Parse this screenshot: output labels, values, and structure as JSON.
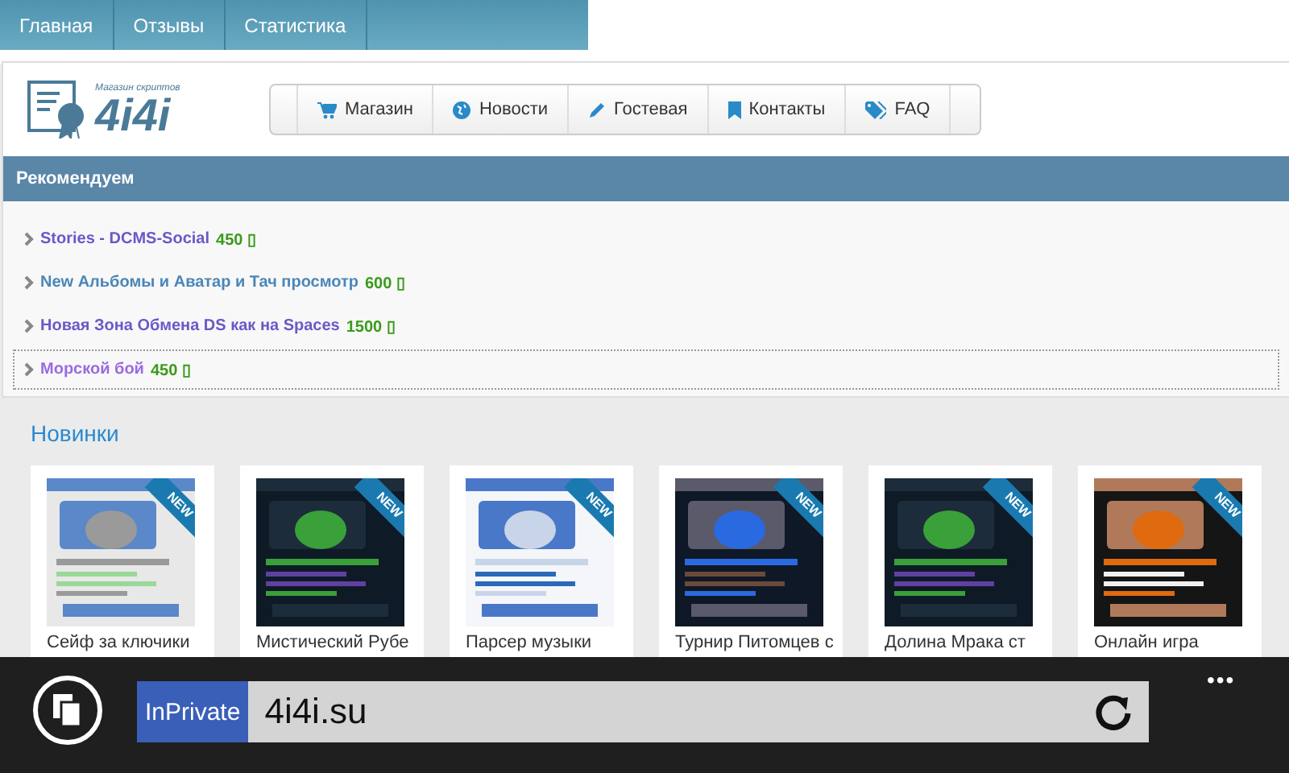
{
  "top_nav": [
    {
      "label": "Главная"
    },
    {
      "label": "Отзывы"
    },
    {
      "label": "Статистика"
    }
  ],
  "logo": {
    "tagline": "Магазин скриптов",
    "text": "4i4i"
  },
  "menu": [
    {
      "label": "Магазин"
    },
    {
      "label": "Новости"
    },
    {
      "label": "Гостевая"
    },
    {
      "label": "Контакты"
    },
    {
      "label": "FAQ"
    }
  ],
  "recommended": {
    "title": "Рекомендуем",
    "items": [
      {
        "name": "Stories - DCMS-Social",
        "price": "450 ▯",
        "visited": true,
        "focused": false
      },
      {
        "name": "New Альбомы и Аватар и Тач просмотр",
        "price": "600 ▯",
        "visited": false,
        "focused": false
      },
      {
        "name": "Новая Зона Обмена DS как на Spaces",
        "price": "1500 ▯",
        "visited": true,
        "focused": false
      },
      {
        "name": "Морской бой",
        "price": "450 ▯",
        "visited": true,
        "focused": true
      }
    ]
  },
  "new_items": {
    "title": "Новинки",
    "cards": [
      {
        "title": "Сейф за ключики",
        "badge": "NEW",
        "kind": "light"
      },
      {
        "title": "Мистический Рубе",
        "badge": "NEW",
        "kind": "dark"
      },
      {
        "title": "Парсер музыки",
        "badge": "NEW",
        "kind": "list"
      },
      {
        "title": "Турнир Питомцев с",
        "badge": "NEW",
        "kind": "game"
      },
      {
        "title": "Долина Мрака ст",
        "badge": "NEW",
        "kind": "dark"
      },
      {
        "title": "Онлайн игра",
        "badge": "NEW",
        "kind": "fighter"
      }
    ]
  },
  "browser_bar": {
    "private_label": "InPrivate",
    "url": "4i4i.su",
    "more": "•••"
  }
}
